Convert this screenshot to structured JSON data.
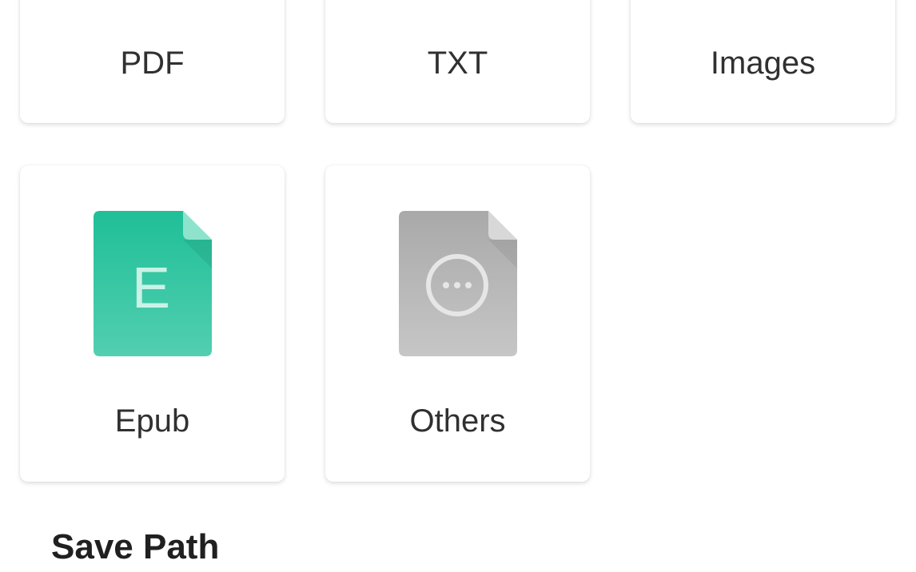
{
  "file_types": [
    {
      "label": "PDF",
      "icon": "pdf-file-icon"
    },
    {
      "label": "TXT",
      "icon": "txt-file-icon"
    },
    {
      "label": "Images",
      "icon": "image-file-icon"
    },
    {
      "label": "Epub",
      "icon": "epub-file-icon",
      "icon_letter": "E",
      "color": "#2ec4a0"
    },
    {
      "label": "Others",
      "icon": "more-file-icon",
      "color": "#bdbdbd"
    }
  ],
  "save_path": {
    "title": "Save Path"
  }
}
